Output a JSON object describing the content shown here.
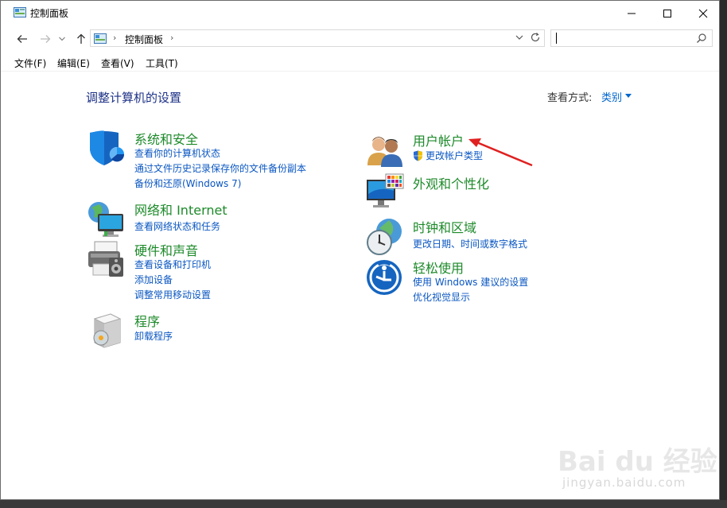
{
  "window": {
    "title": "控制面板"
  },
  "address": {
    "breadcrumb": "控制面板",
    "separator": "›",
    "search_placeholder": ""
  },
  "menu": {
    "file": "文件(F)",
    "edit": "编辑(E)",
    "view": "查看(V)",
    "tools": "工具(T)"
  },
  "main": {
    "heading": "调整计算机的设置",
    "view_by_label": "查看方式:",
    "view_by_value": "类别"
  },
  "categories": {
    "system": {
      "title": "系统和安全",
      "links": [
        "查看你的计算机状态",
        "通过文件历史记录保存你的文件备份副本",
        "备份和还原(Windows 7)"
      ]
    },
    "network": {
      "title": "网络和 Internet",
      "links": [
        "查看网络状态和任务"
      ]
    },
    "hardware": {
      "title": "硬件和声音",
      "links": [
        "查看设备和打印机",
        "添加设备",
        "调整常用移动设置"
      ]
    },
    "programs": {
      "title": "程序",
      "links": [
        "卸载程序"
      ]
    },
    "users": {
      "title": "用户帐户",
      "links": [
        "更改帐户类型"
      ]
    },
    "appearance": {
      "title": "外观和个性化",
      "links": []
    },
    "clock": {
      "title": "时钟和区域",
      "links": [
        "更改日期、时间或数字格式"
      ]
    },
    "ease": {
      "title": "轻松使用",
      "links": [
        "使用 Windows 建议的设置",
        "优化视觉显示"
      ]
    }
  },
  "watermark": {
    "brand": "Bai du 经验",
    "url": "jingyan.baidu.com"
  },
  "colors": {
    "category_title": "#1d8a2a",
    "link": "#0b57c2",
    "heading": "#1e3287",
    "annotation_arrow": "#e02020"
  }
}
